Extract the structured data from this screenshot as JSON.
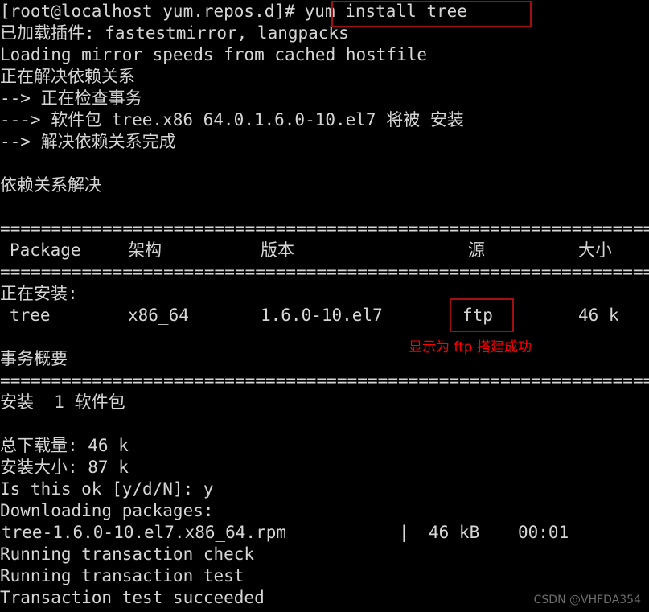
{
  "terminal": {
    "theme": {
      "background": "#000000",
      "foreground": "#d6d6d6",
      "highlight_box": "#a01010",
      "annotation": "#ff0000",
      "watermark": "#6d6d6d"
    },
    "prompt": {
      "full": "[root@localhost yum.repos.d]#",
      "user": "root",
      "host": "localhost",
      "cwd": "yum.repos.d",
      "symbol": "#"
    },
    "command": "yum install tree",
    "separator_line": "==============================================================================",
    "lines": {
      "loaded_plugins": "已加载插件: fastestmirror, langpacks",
      "loading_mirror": "Loading mirror speeds from cached hostfile",
      "resolving_deps": "正在解决依赖关系",
      "checking_transaction": "--> 正在检查事务",
      "package_will_be_installed": "---> 软件包 tree.x86_64.0.1.6.0-10.el7 将被 安装",
      "deps_resolved_arrow": "--> 解决依赖关系完成",
      "deps_resolved_title": "依赖关系解决",
      "installing_label": "正在安装:",
      "transaction_summary_title": "事务概要",
      "install_count": "安装  1 软件包",
      "total_download_size": "总下载量: 46 k",
      "installed_size": "安装大小: 87 k",
      "confirm_prompt": "Is this ok [y/d/N]: y",
      "downloading_packages": "Downloading packages:",
      "running_transaction_check": "Running transaction check",
      "running_transaction_test": "Running transaction test",
      "transaction_test_succeeded": "Transaction test succeeded"
    },
    "table": {
      "headers": {
        "package": "Package",
        "arch": "架构",
        "version": "版本",
        "repo": "源",
        "size": "大小"
      },
      "row": {
        "package": "tree",
        "arch": "x86_64",
        "version": "1.6.0-10.el7",
        "repo": "ftp",
        "size": "46 k"
      }
    },
    "download_progress": {
      "filename": "tree-1.6.0-10.el7.x86_64.rpm",
      "pipe": "|",
      "size": "46 kB",
      "time": "00:01"
    },
    "annotations": {
      "ftp_note": "显示为 ftp 搭建成功"
    },
    "watermark": "CSDN @VHFDA354"
  }
}
